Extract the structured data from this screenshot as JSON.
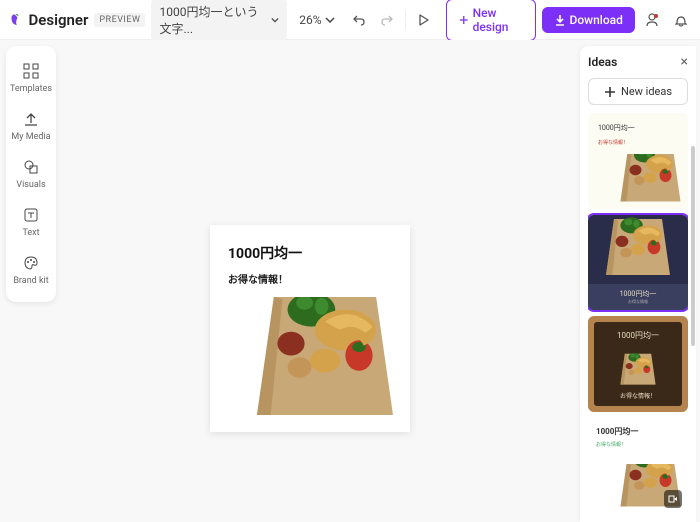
{
  "app": {
    "name": "Designer",
    "preview": "PREVIEW"
  },
  "file": {
    "name": "1000円均一という文字..."
  },
  "zoom": {
    "value": "26%"
  },
  "toolbar": {
    "newDesign": "New design",
    "download": "Download"
  },
  "sidebar": {
    "templates": "Templates",
    "myMedia": "My Media",
    "visuals": "Visuals",
    "text": "Text",
    "brandKit": "Brand kit"
  },
  "canvas": {
    "title": "1000円均一",
    "sub": "お得な情報！"
  },
  "ideas": {
    "title": "Ideas",
    "newIdeas": "New ideas",
    "thumbs": [
      {
        "title": "1000円均一",
        "sub": "お得な情報！"
      },
      {
        "title": "1000円均一",
        "sub": "お得な情報"
      },
      {
        "title": "1000円均一",
        "sub": "お得な情報！"
      },
      {
        "title": "1000円均一",
        "sub": "お得な情報！"
      }
    ]
  }
}
